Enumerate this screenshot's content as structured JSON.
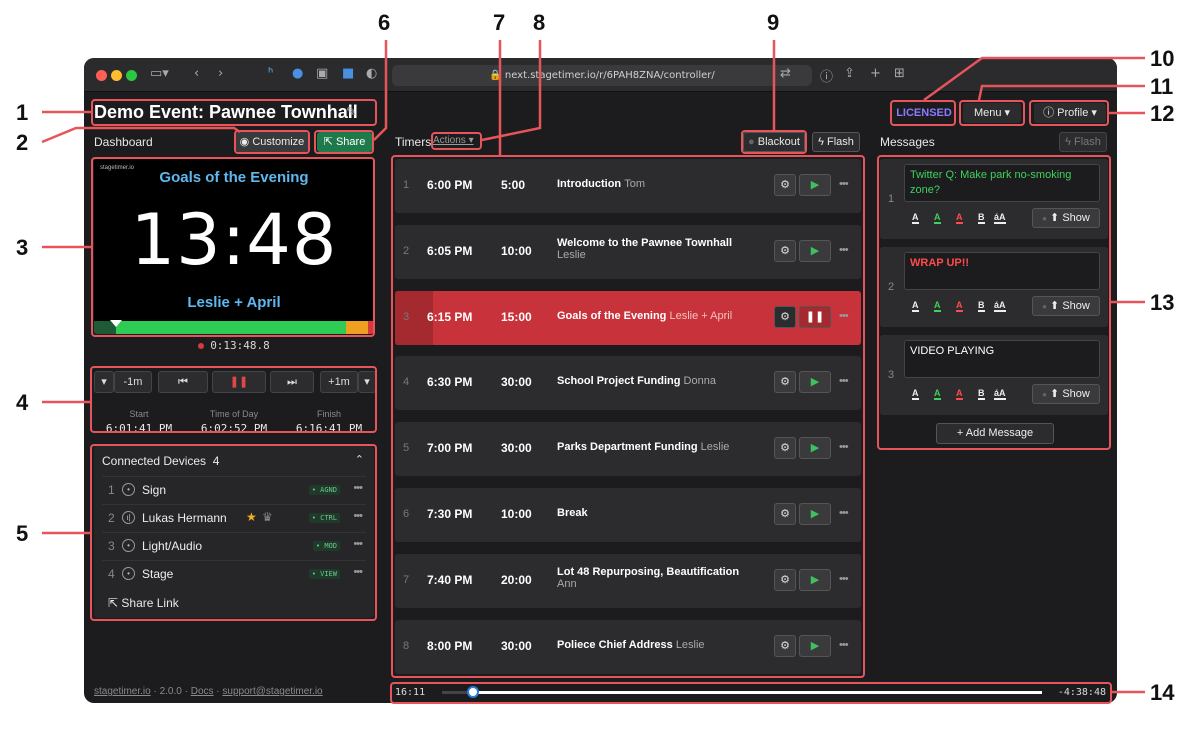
{
  "browser": {
    "url": "next.stagetimer.io/r/6PAH8ZNA/controller/"
  },
  "event": {
    "title": "Demo Event: Pawnee Townhall"
  },
  "left": {
    "dashboard_label": "Dashboard",
    "customize_label": "Customize",
    "share_label": "Share",
    "preview": {
      "logo": "stagetimer.io",
      "title": "Goals of the Evening",
      "clock": "13:48",
      "speaker": "Leslie + April",
      "progress": 0.08
    },
    "elapsed": "0:13:48.8",
    "controls": {
      "minus": "-1m",
      "plus": "+1m",
      "start_label": "Start",
      "start_value": "6:01:41 PM",
      "tod_label": "Time of Day",
      "tod_value": "6:02:52 PM",
      "finish_label": "Finish",
      "finish_value": "6:16:41 PM"
    },
    "devices": {
      "title": "Connected Devices",
      "count": "4",
      "items": [
        {
          "num": "1",
          "name": "Sign",
          "badge": "• AGND"
        },
        {
          "num": "2",
          "name": "Lukas Hermann",
          "badge": "• CTRL"
        },
        {
          "num": "3",
          "name": "Light/Audio",
          "badge": "• MOD"
        },
        {
          "num": "4",
          "name": "Stage",
          "badge": "• VIEW"
        }
      ],
      "share_link": "Share Link"
    },
    "footer": {
      "site": "stagetimer.io",
      "version": "2.0.0",
      "docs": "Docs",
      "support": "support@stagetimer.io"
    }
  },
  "timers": {
    "label": "Timers",
    "actions": "Actions",
    "blackout": "Blackout",
    "flash": "Flash",
    "rows": [
      {
        "num": "1",
        "time": "6:00 PM",
        "dur": "5:00",
        "name": "Introduction",
        "speaker": "Tom",
        "active": false
      },
      {
        "num": "2",
        "time": "6:05 PM",
        "dur": "10:00",
        "name": "Welcome to the Pawnee Townhall",
        "speaker": "Leslie",
        "active": false
      },
      {
        "num": "3",
        "time": "6:15 PM",
        "dur": "15:00",
        "name": "Goals of the Evening",
        "speaker": "Leslie + April",
        "active": true
      },
      {
        "num": "4",
        "time": "6:30 PM",
        "dur": "30:00",
        "name": "School Project Funding",
        "speaker": "Donna",
        "active": false
      },
      {
        "num": "5",
        "time": "7:00 PM",
        "dur": "30:00",
        "name": "Parks Department Funding",
        "speaker": "Leslie",
        "active": false
      },
      {
        "num": "6",
        "time": "7:30 PM",
        "dur": "10:00",
        "name": "Break",
        "speaker": "",
        "active": false
      },
      {
        "num": "7",
        "time": "7:40 PM",
        "dur": "20:00",
        "name": "Lot 48 Repurposing, Beautification",
        "speaker": "Ann",
        "active": false
      },
      {
        "num": "8",
        "time": "8:00 PM",
        "dur": "30:00",
        "name": "Poliece Chief Address",
        "speaker": "Leslie",
        "active": false
      }
    ],
    "timeline_left": "16:11",
    "timeline_right": "-4:38:48"
  },
  "header_right": {
    "licensed": "LICENSED",
    "menu": "Menu",
    "profile": "Profile"
  },
  "messages": {
    "label": "Messages",
    "flash": "Flash",
    "items": [
      {
        "num": "1",
        "text": "Twitter Q: Make park no-smoking zone?",
        "color": "#3fd15e",
        "bold": false
      },
      {
        "num": "2",
        "text": "WRAP UP!!",
        "color": "#ff4b4b",
        "bold": true
      },
      {
        "num": "3",
        "text": "VIDEO PLAYING",
        "color": "#ffffff",
        "bold": false
      }
    ],
    "show_label": "Show",
    "add_label": "Add Message"
  },
  "callouts": [
    "1",
    "2",
    "3",
    "4",
    "5",
    "6",
    "7",
    "8",
    "9",
    "10",
    "11",
    "12",
    "13",
    "14"
  ]
}
